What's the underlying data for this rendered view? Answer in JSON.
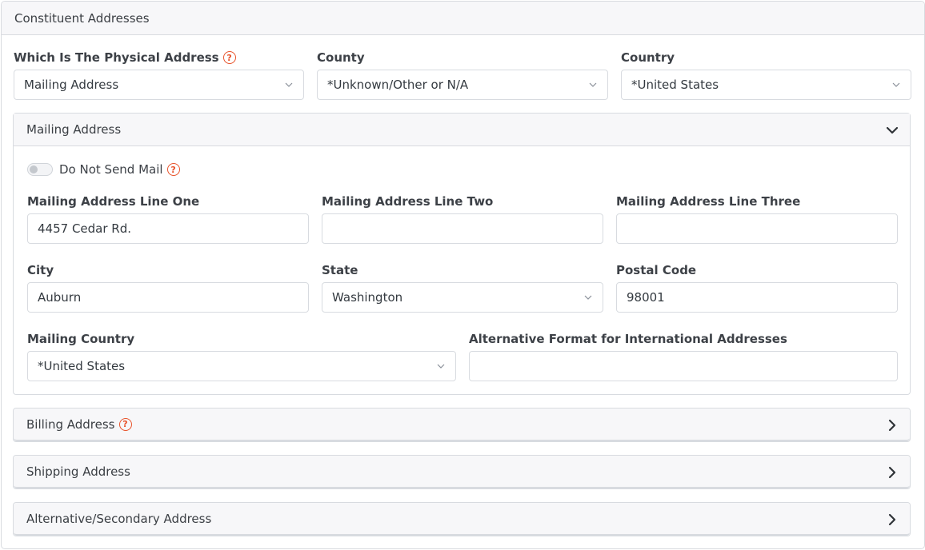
{
  "card": {
    "title": "Constituent Addresses"
  },
  "top": {
    "physical_label": "Which Is The Physical Address",
    "physical_value": "Mailing Address",
    "county_label": "County",
    "county_value": "*Unknown/Other or N/A",
    "country_label": "Country",
    "country_value": "*United States"
  },
  "mailing": {
    "title": "Mailing Address",
    "do_not_send_label": "Do Not Send Mail",
    "do_not_send": false,
    "line1_label": "Mailing Address Line One",
    "line1_value": "4457 Cedar Rd.",
    "line2_label": "Mailing Address Line Two",
    "line2_value": "",
    "line3_label": "Mailing Address Line Three",
    "line3_value": "",
    "city_label": "City",
    "city_value": "Auburn",
    "state_label": "State",
    "state_value": "Washington",
    "postal_label": "Postal Code",
    "postal_value": "98001",
    "country_label": "Mailing Country",
    "country_value": "*United States",
    "alt_label": "Alternative Format for International Addresses",
    "alt_value": ""
  },
  "sections": {
    "billing": "Billing Address",
    "shipping": "Shipping Address",
    "alternative": "Alternative/Secondary Address"
  },
  "icons": {
    "help": "question-circle-icon",
    "chevron_down": "chevron-down-icon",
    "chevron_right": "chevron-right-icon"
  },
  "colors": {
    "help_accent": "#e8532b"
  }
}
